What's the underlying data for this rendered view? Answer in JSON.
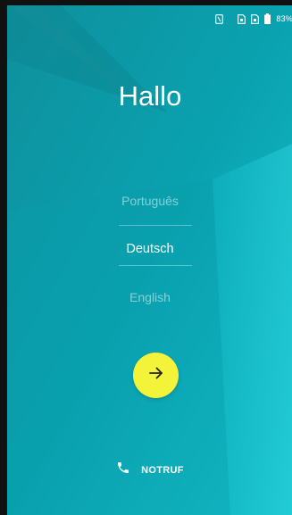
{
  "status_bar": {
    "icons": [
      "nfc-icon",
      "sim-card-icon",
      "sim-card-icon",
      "battery-icon"
    ],
    "battery_text": "83%"
  },
  "welcome": {
    "title": "Hallo"
  },
  "language_picker": {
    "options": [
      "Português",
      "Deutsch",
      "English"
    ],
    "selected": "Deutsch"
  },
  "next_button": {
    "icon": "arrow-right-icon"
  },
  "emergency": {
    "icon": "phone-icon",
    "label": "NOTRUF"
  },
  "colors": {
    "background": "#0a9aa8",
    "accent": "#f3f33a",
    "text": "#ffffff"
  }
}
